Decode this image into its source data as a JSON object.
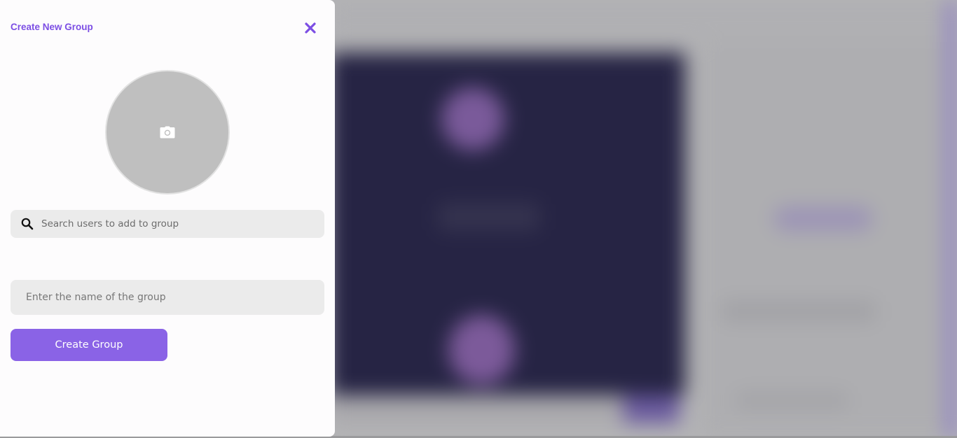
{
  "modal": {
    "title": "Create New Group",
    "close_icon": "close-icon",
    "avatar": {
      "icon": "camera-icon"
    },
    "search": {
      "placeholder": "Search users to add to group",
      "value": "",
      "icon": "search-icon"
    },
    "group_name": {
      "placeholder": "Enter the name of the group",
      "value": ""
    },
    "create_button_label": "Create Group"
  },
  "colors": {
    "accent": "#7c4ee4",
    "button": "#8a63e6",
    "input_bg": "#ebebeb",
    "avatar_bg": "#bfbfbf",
    "backdrop_chat": "#262444"
  }
}
